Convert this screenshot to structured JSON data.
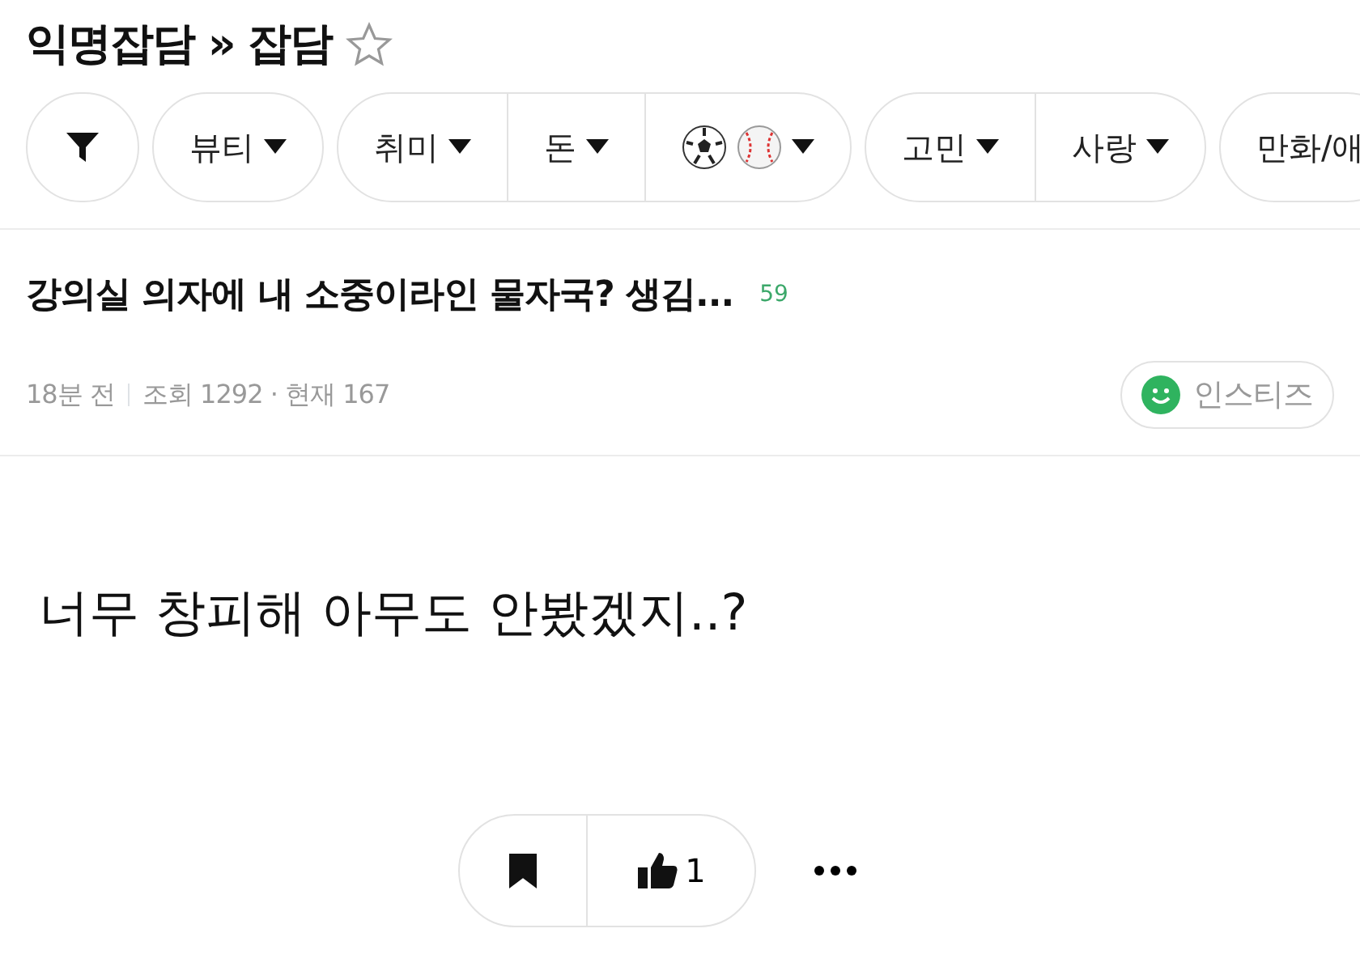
{
  "board": {
    "title": "익명잡담 » 잡담",
    "favorite": false
  },
  "filter_groups": [
    {
      "items": [
        {
          "kind": "filter"
        }
      ]
    },
    {
      "items": [
        {
          "kind": "text",
          "label": "뷰티",
          "caret": true
        }
      ]
    },
    {
      "items": [
        {
          "kind": "text",
          "label": "취미",
          "caret": true
        },
        {
          "kind": "text",
          "label": "돈",
          "caret": true
        },
        {
          "kind": "balls",
          "caret": true
        }
      ]
    },
    {
      "items": [
        {
          "kind": "text",
          "label": "고민",
          "caret": true
        },
        {
          "kind": "text",
          "label": "사랑",
          "caret": true
        }
      ]
    },
    {
      "items": [
        {
          "kind": "text",
          "label": "만화/애",
          "caret": false
        }
      ]
    }
  ],
  "post": {
    "title": "강의실 의자에 내 소중이라인 물자국? 생김...",
    "comment_count": "59",
    "time": "18분 전",
    "views": "조회 1292 · 현재 167",
    "source": "인스티즈",
    "body": "너무 창피해 아무도 안봤겠지..?"
  },
  "actions": {
    "likes": "1"
  }
}
